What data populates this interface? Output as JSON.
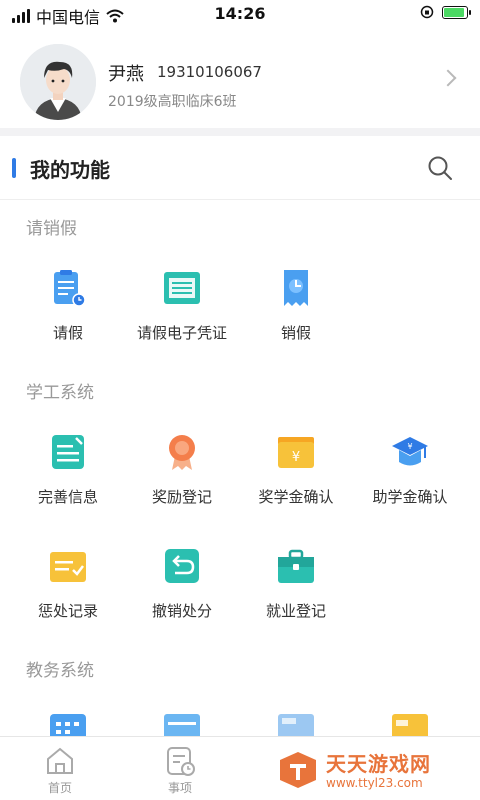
{
  "status_bar": {
    "carrier": "中国电信",
    "time": "14:26",
    "battery_level": 0.9
  },
  "profile": {
    "name": "尹燕",
    "phone": "19310106067",
    "class": "2019级高职临床6班"
  },
  "functions": {
    "title": "我的功能"
  },
  "groups": [
    {
      "title": "请销假",
      "items": [
        {
          "label": "请假",
          "icon": "clipboard-clock-icon"
        },
        {
          "label": "请假电子凭证",
          "icon": "voucher-icon"
        },
        {
          "label": "销假",
          "icon": "receipt-icon"
        }
      ]
    },
    {
      "title": "学工系统",
      "items": [
        {
          "label": "完善信息",
          "icon": "notebook-edit-icon"
        },
        {
          "label": "奖励登记",
          "icon": "medal-icon"
        },
        {
          "label": "奖学金确认",
          "icon": "yuan-wallet-icon"
        },
        {
          "label": "助学金确认",
          "icon": "grad-cap-icon"
        },
        {
          "label": "惩处记录",
          "icon": "folder-check-icon"
        },
        {
          "label": "撤销处分",
          "icon": "undo-icon"
        },
        {
          "label": "就业登记",
          "icon": "briefcase-icon"
        }
      ]
    },
    {
      "title": "教务系统",
      "items": []
    }
  ],
  "bottom_nav": [
    {
      "label": "首页",
      "icon": "home-icon"
    },
    {
      "label": "事项",
      "icon": "tasks-icon"
    }
  ],
  "watermark": {
    "title": "天天游戏网",
    "url": "www.ttyl23.com"
  },
  "colors": {
    "accent": "#2f7be5",
    "teal": "#2bbfb0",
    "blue_icon": "#4a9ff0",
    "orange": "#f29b38",
    "yellow": "#f7c23a",
    "watermark": "#e8743b"
  }
}
